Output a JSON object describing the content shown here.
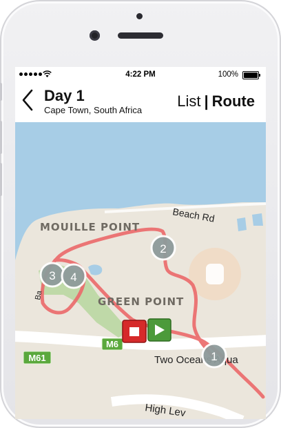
{
  "status_bar": {
    "time": "4:22 PM",
    "battery": "100%"
  },
  "header": {
    "title": "Day 1",
    "subtitle": "Cape Town, South Africa",
    "view_toggle": {
      "list_label": "List",
      "separator": "|",
      "route_label": "Route",
      "selected": "Route"
    }
  },
  "map": {
    "labels": {
      "area1": "MOUILLE POINT",
      "area2": "GREEN POINT",
      "road1": "Beach Rd",
      "road2": "Two Oceans Aqua",
      "road3": "High Lev",
      "road4": "Ba",
      "shield1": "M6",
      "shield2": "M61"
    },
    "stops": [
      {
        "number": "1"
      },
      {
        "number": "2"
      },
      {
        "number": "3"
      },
      {
        "number": "4"
      }
    ],
    "controls": {
      "stop_icon": "stop-icon",
      "play_icon": "play-icon"
    },
    "colors": {
      "water": "#a7cde6",
      "land": "#ebe6dc",
      "park": "#bfd9a8",
      "route": "#ea6b6b",
      "stop_red": "#d62a2a",
      "play_green": "#4c9a3a"
    }
  }
}
